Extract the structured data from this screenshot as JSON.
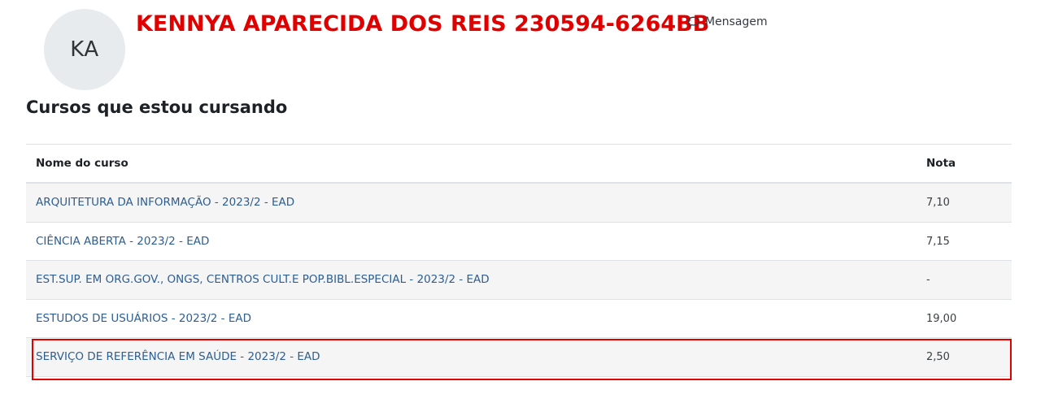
{
  "profile": {
    "avatar_initials": "KA",
    "name": "KENNYA APARECIDA DOS REIS 230594-6264BB",
    "message_label": "Mensagem",
    "message_icon": "speech-bubble-icon"
  },
  "section": {
    "title": "Cursos que estou cursando"
  },
  "table": {
    "headers": {
      "course": "Nome do curso",
      "grade": "Nota"
    },
    "rows": [
      {
        "course": "ARQUITETURA DA INFORMAÇÃO - 2023/2 - EAD",
        "grade": "7,10"
      },
      {
        "course": "CIÊNCIA ABERTA - 2023/2 - EAD",
        "grade": "7,15"
      },
      {
        "course": "EST.SUP. EM ORG.GOV., ONGS, CENTROS CULT.E POP.BIBL.ESPECIAL - 2023/2 - EAD",
        "grade": "-"
      },
      {
        "course": "ESTUDOS DE USUÁRIOS - 2023/2 - EAD",
        "grade": "19,00"
      },
      {
        "course": "SERVIÇO DE REFERÊNCIA EM SAÚDE - 2023/2 - EAD",
        "grade": "2,50"
      }
    ]
  },
  "colors": {
    "name_red": "#e00000",
    "link_blue": "#2d5e90",
    "highlight_red": "#e00000",
    "row_alt_bg": "#f5f5f5"
  }
}
